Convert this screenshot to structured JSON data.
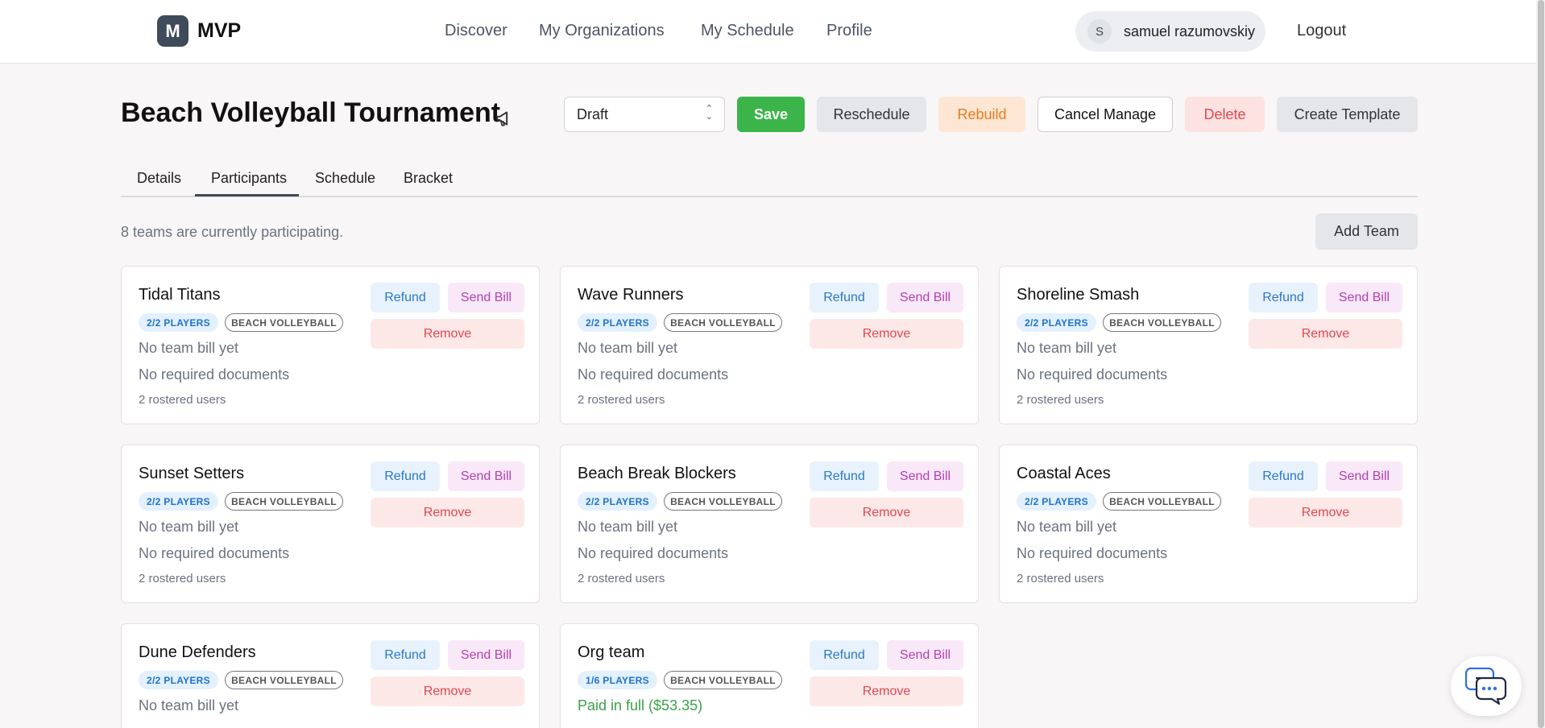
{
  "header": {
    "logo_letter": "M",
    "logo_text": "MVP",
    "nav": [
      "Discover",
      "My Organizations",
      "My Schedule",
      "Profile"
    ],
    "user_initial": "S",
    "user_name": "samuel razumovskiy",
    "logout": "Logout"
  },
  "event": {
    "title": "Beach Volleyball Tournament",
    "status": "Draft",
    "actions": {
      "save": "Save",
      "reschedule": "Reschedule",
      "rebuild": "Rebuild",
      "cancel_manage": "Cancel Manage",
      "delete": "Delete",
      "create_template": "Create Template"
    }
  },
  "tabs": [
    "Details",
    "Participants",
    "Schedule",
    "Bracket"
  ],
  "active_tab": "Participants",
  "participants": {
    "summary": "8 teams are currently participating.",
    "add_team": "Add Team",
    "buttons": {
      "refund": "Refund",
      "send_bill": "Send Bill",
      "remove": "Remove"
    },
    "teams": [
      {
        "name": "Tidal Titans",
        "players": "2/2 PLAYERS",
        "sport": "BEACH VOLLEYBALL",
        "bill": "No team bill yet",
        "docs": "No required documents",
        "rostered": "2 rostered users"
      },
      {
        "name": "Wave Runners",
        "players": "2/2 PLAYERS",
        "sport": "BEACH VOLLEYBALL",
        "bill": "No team bill yet",
        "docs": "No required documents",
        "rostered": "2 rostered users"
      },
      {
        "name": "Shoreline Smash",
        "players": "2/2 PLAYERS",
        "sport": "BEACH VOLLEYBALL",
        "bill": "No team bill yet",
        "docs": "No required documents",
        "rostered": "2 rostered users"
      },
      {
        "name": "Sunset Setters",
        "players": "2/2 PLAYERS",
        "sport": "BEACH VOLLEYBALL",
        "bill": "No team bill yet",
        "docs": "No required documents",
        "rostered": "2 rostered users"
      },
      {
        "name": "Beach Break Blockers",
        "players": "2/2 PLAYERS",
        "sport": "BEACH VOLLEYBALL",
        "bill": "No team bill yet",
        "docs": "No required documents",
        "rostered": "2 rostered users"
      },
      {
        "name": "Coastal Aces",
        "players": "2/2 PLAYERS",
        "sport": "BEACH VOLLEYBALL",
        "bill": "No team bill yet",
        "docs": "No required documents",
        "rostered": "2 rostered users"
      },
      {
        "name": "Dune Defenders",
        "players": "2/2 PLAYERS",
        "sport": "BEACH VOLLEYBALL",
        "bill": "No team bill yet"
      },
      {
        "name": "Org team",
        "players": "1/6 PLAYERS",
        "sport": "BEACH VOLLEYBALL",
        "bill": "Paid in full ($53.35)",
        "bill_status": "paid"
      }
    ]
  },
  "colors": {
    "save": "#3bb54a",
    "rebuild_text": "#ea7a1c",
    "delete_text": "#e0484e",
    "players_badge": "#1e73c8",
    "paid_text": "#3aa14a"
  },
  "icons": [
    "megaphone-icon",
    "chevron-updown-icon",
    "chat-icon"
  ]
}
